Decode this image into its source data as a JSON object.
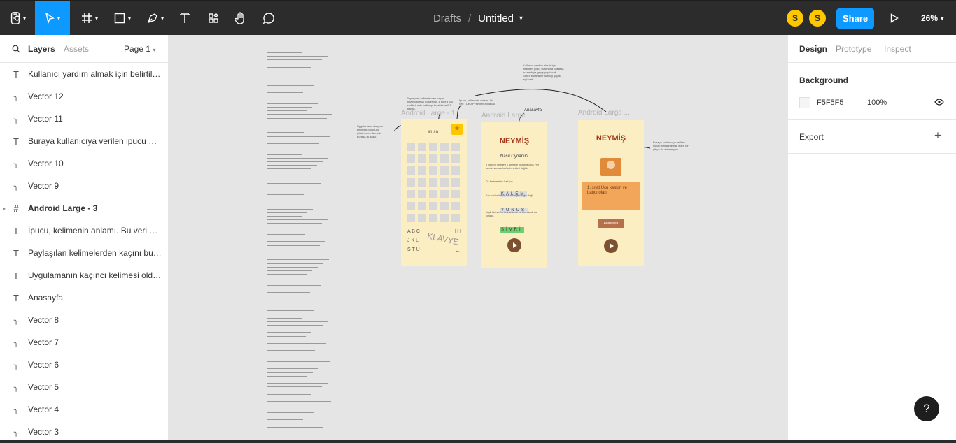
{
  "topbar": {
    "tools": [
      "figma-menu",
      "move-tool",
      "frame-tool",
      "shape-tool",
      "pen-tool",
      "text-tool",
      "resources-tool",
      "hand-tool",
      "comment-tool"
    ],
    "drafts": "Drafts",
    "separator": "/",
    "file_name": "Untitled",
    "avatars": [
      "S",
      "S"
    ],
    "share": "Share",
    "zoom": "26%"
  },
  "left": {
    "tabs": {
      "layers": "Layers",
      "assets": "Assets"
    },
    "page": "Page 1",
    "layers": [
      {
        "icon": "T",
        "label": "Kullanıcı yardım almak için belirtilen..."
      },
      {
        "icon": "vector",
        "label": "Vector 12"
      },
      {
        "icon": "vector",
        "label": "Vector 11"
      },
      {
        "icon": "T",
        "label": "Buraya kullanıcıya verilen ipucu metni..."
      },
      {
        "icon": "vector",
        "label": "Vector 10"
      },
      {
        "icon": "vector",
        "label": "Vector 9"
      },
      {
        "icon": "frame",
        "label": "Android Large - 3"
      },
      {
        "icon": "T",
        "label": "İpucu, kelimenin anlamı. Bu veri TDK'..."
      },
      {
        "icon": "T",
        "label": "Paylaşılan kelimelerden kaçını bulabildiği..."
      },
      {
        "icon": "T",
        "label": "Uygulamanın kaçıncı kelimesi olduğu..."
      },
      {
        "icon": "T",
        "label": "Anasayfa"
      },
      {
        "icon": "vector",
        "label": "Vector 8"
      },
      {
        "icon": "vector",
        "label": "Vector 7"
      },
      {
        "icon": "vector",
        "label": "Vector 6"
      },
      {
        "icon": "vector",
        "label": "Vector 5"
      },
      {
        "icon": "vector",
        "label": "Vector 4"
      },
      {
        "icon": "vector",
        "label": "Vector 3"
      }
    ]
  },
  "right": {
    "tabs": {
      "design": "Design",
      "prototype": "Prototype",
      "inspect": "Inspect"
    },
    "background_label": "Background",
    "bg_hex": "F5F5F5",
    "bg_opacity": "100%",
    "export_label": "Export"
  },
  "canvas": {
    "frame_label": "Android Large ...",
    "frame_label_a": "Android Large - 1",
    "frame_label_b": "Android Large ...",
    "frame_label_c": "Android Large ...",
    "app_title": "NEYMİŞ",
    "how_to": "Nasıl Oynanır?",
    "word_kalem": "KALEM",
    "word_yunus": "YUNUS",
    "word_sivri": "SİVRİ",
    "counter": "#1 / 0",
    "keyboard_label": "KLAVYE",
    "kb_row1": "A B C",
    "kb_row2": "J K L",
    "kb_row3": "Ş T U",
    "anasayfa": "Anasayfa",
    "hint_text": "1. sıfat Ucu keskin ve batıcı olan",
    "anasayfa_button": "Anasayfa",
    "anasayfa_note": "Anasayfa"
  },
  "help": "?",
  "colors": {
    "accent": "#0d99ff",
    "topbar": "#2c2c2c",
    "avatar": "#ffc700",
    "frame": "#fbeec3",
    "hint_box": "#f2a65a",
    "brown": "#7d5130"
  }
}
